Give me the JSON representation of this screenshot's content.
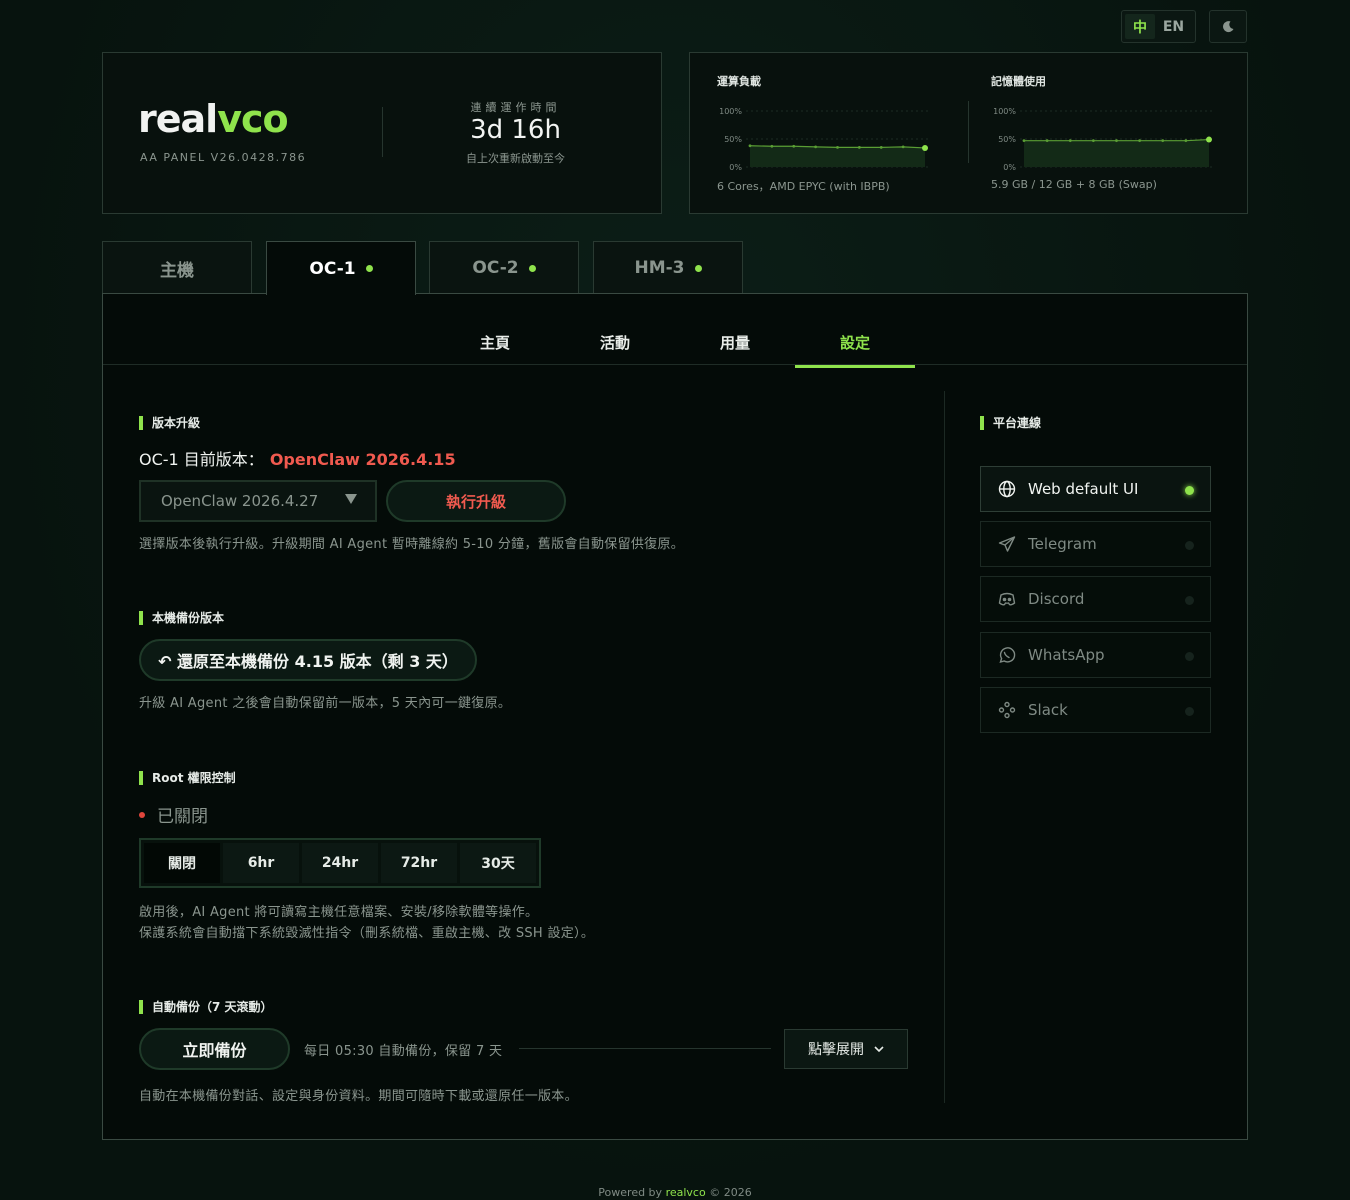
{
  "header": {
    "lang_zh": "中",
    "lang_en": "EN",
    "theme_icon": "moon-icon",
    "brand_real": "real",
    "brand_vco": "vco",
    "panel_version": "AA PANEL V26.0428.786",
    "uptime_label": "連續運作時間",
    "uptime_value": "3d 16h",
    "uptime_sub": "自上次重新啟動至今"
  },
  "stats": {
    "cpu_title": "運算負載",
    "cpu_foot": "6 Cores，AMD EPYC (with IBPB)",
    "cpu_series": [
      38,
      37,
      37,
      36,
      35,
      35,
      35,
      36,
      34
    ],
    "mem_title": "記憶體使用",
    "mem_foot": "5.9 GB / 12 GB + 8 GB (Swap)",
    "mem_series": [
      47,
      47,
      47,
      47,
      47,
      47,
      47,
      47,
      49
    ],
    "tick_100": "100%",
    "tick_50": "50%",
    "tick_0": "0%"
  },
  "machine_tabs": [
    {
      "label": "主機",
      "online": false
    },
    {
      "label": "OC-1",
      "online": true
    },
    {
      "label": "OC-2",
      "online": true
    },
    {
      "label": "HM-3",
      "online": true
    }
  ],
  "sub_tabs": [
    "主頁",
    "活動",
    "用量",
    "設定"
  ],
  "upgrade": {
    "title": "版本升級",
    "current_prefix": "OC-1 目前版本：",
    "current_version": "OpenClaw 2026.4.15",
    "selected_version": "OpenClaw 2026.4.27",
    "button": "執行升級",
    "help": "選擇版本後執行升級。升級期間 AI Agent 暫時離線約 5-10 分鐘，舊版會自動保留供復原。"
  },
  "local_backup": {
    "title": "本機備份版本",
    "button": "↶ 還原至本機備份 4.15 版本（剩 3 天）",
    "help": "升級 AI Agent 之後會自動保留前一版本，5 天內可一鍵復原。"
  },
  "root": {
    "title": "Root 權限控制",
    "status": "已關閉",
    "options": [
      "關閉",
      "6hr",
      "24hr",
      "72hr",
      "30天"
    ],
    "help_1": "啟用後，AI Agent 將可讀寫主機任意檔案、安裝/移除軟體等操作。",
    "help_2": "保護系統會自動擋下系統毀滅性指令（刪系統檔、重啟主機、改 SSH 設定）。"
  },
  "auto_backup": {
    "title": "自動備份（7 天滾動）",
    "button": "立即備份",
    "schedule": "每日 05:30 自動備份，保留 7 天",
    "expand": "點擊展開",
    "help": "自動在本機備份對話、設定與身份資料。期間可隨時下載或還原任一版本。"
  },
  "platforms": {
    "title": "平台連線",
    "items": [
      {
        "label": "Web default UI",
        "icon": "globe-icon",
        "active": true
      },
      {
        "label": "Telegram",
        "icon": "telegram-icon",
        "active": false
      },
      {
        "label": "Discord",
        "icon": "discord-icon",
        "active": false
      },
      {
        "label": "WhatsApp",
        "icon": "whatsapp-icon",
        "active": false
      },
      {
        "label": "Slack",
        "icon": "slack-icon",
        "active": false
      }
    ]
  },
  "footer": {
    "prefix": "Powered by",
    "brand": "realvco",
    "suffix": "© 2026"
  },
  "colors": {
    "accent": "#8fe34c",
    "danger": "#f05a4f",
    "background": "#07130e"
  }
}
